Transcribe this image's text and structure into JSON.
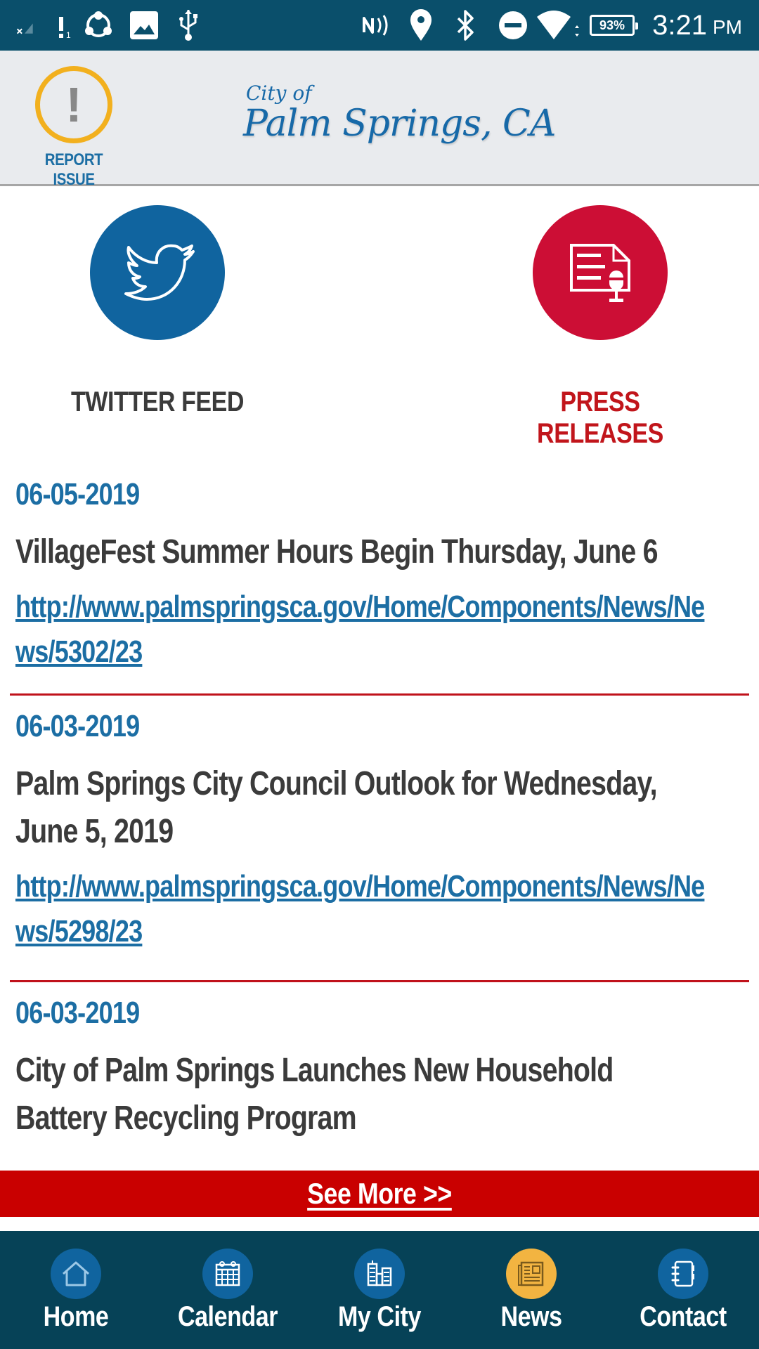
{
  "status_bar": {
    "time": "3:21",
    "ampm": "PM",
    "battery": "93%",
    "sim_indicator": "1",
    "icons": [
      "no-signal-icon",
      "sync-icon",
      "image-icon",
      "usb-icon",
      "nfc-icon",
      "location-icon",
      "bluetooth-icon",
      "do-not-disturb-icon",
      "wifi-icon",
      "battery-icon"
    ]
  },
  "header": {
    "report_issue_label": "REPORT ISSUE",
    "logo_small": "City of",
    "logo_main": "Palm Springs, CA"
  },
  "tiles": [
    {
      "label": "TWITTER FEED",
      "icon": "twitter-bird-icon",
      "color": "#10649f"
    },
    {
      "label": "PRESS RELEASES",
      "icon": "press-release-icon",
      "color": "#cc0e35"
    }
  ],
  "news": [
    {
      "date": "06-05-2019",
      "title": "VillageFest Summer Hours Begin Thursday, June 6",
      "link": "http://www.palmspringsca.gov/Home/Components/News/News/5302/23"
    },
    {
      "date": "06-03-2019",
      "title": "Palm Springs City Council Outlook for Wednesday, June 5, 2019",
      "link": "http://www.palmspringsca.gov/Home/Components/News/News/5298/23"
    },
    {
      "date": "06-03-2019",
      "title": "City of Palm Springs Launches New Household Battery Recycling Program"
    }
  ],
  "see_more_label": "See More >>",
  "bottom_nav": [
    {
      "label": "Home",
      "icon": "home-icon",
      "active": false
    },
    {
      "label": "Calendar",
      "icon": "calendar-icon",
      "active": false
    },
    {
      "label": "My City",
      "icon": "city-buildings-icon",
      "active": false
    },
    {
      "label": "News",
      "icon": "newspaper-icon",
      "active": true
    },
    {
      "label": "Contact",
      "icon": "address-book-icon",
      "active": false
    }
  ],
  "colors": {
    "status_bar": "#0a4f6b",
    "brand_blue": "#1c6ea4",
    "accent_red": "#c90000",
    "nav_bg": "#064257",
    "nav_active": "#f2b441"
  }
}
